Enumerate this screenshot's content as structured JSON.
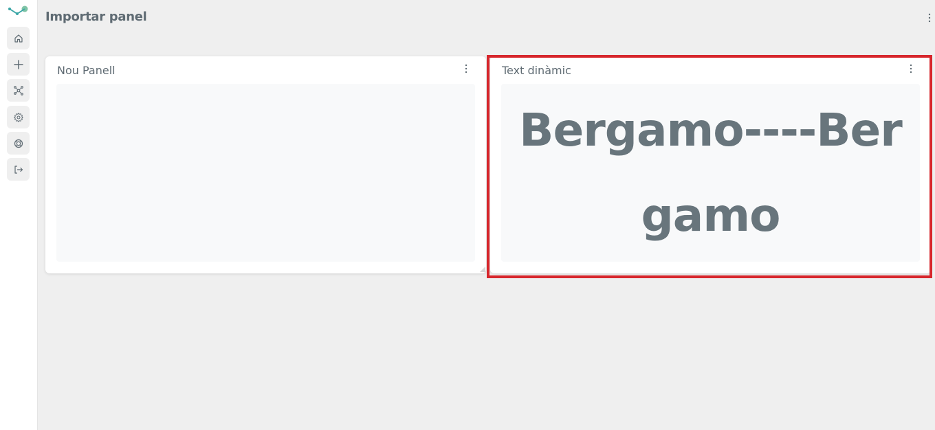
{
  "page": {
    "title": "Importar panel",
    "menu_icon": "more-vertical-icon"
  },
  "sidebar": {
    "logo_icon": "app-logo-icon",
    "items": [
      {
        "icon": "home-icon"
      },
      {
        "icon": "plus-icon"
      },
      {
        "icon": "network-icon"
      },
      {
        "icon": "gear-icon"
      },
      {
        "icon": "lifebuoy-icon"
      },
      {
        "icon": "logout-icon"
      }
    ]
  },
  "panels": [
    {
      "title": "Nou Panell",
      "content": ""
    },
    {
      "title": "Text dinàmic",
      "content": "Bergamo----Bergamo"
    }
  ],
  "colors": {
    "background": "#efefef",
    "card": "#ffffff",
    "card_body": "#f8f9fa",
    "text": "#5f6b73",
    "dynamic_text": "#68757c",
    "highlight_border": "#d7262c",
    "logo_teal": "#3aa6a6",
    "logo_green": "#7fc4a6"
  }
}
